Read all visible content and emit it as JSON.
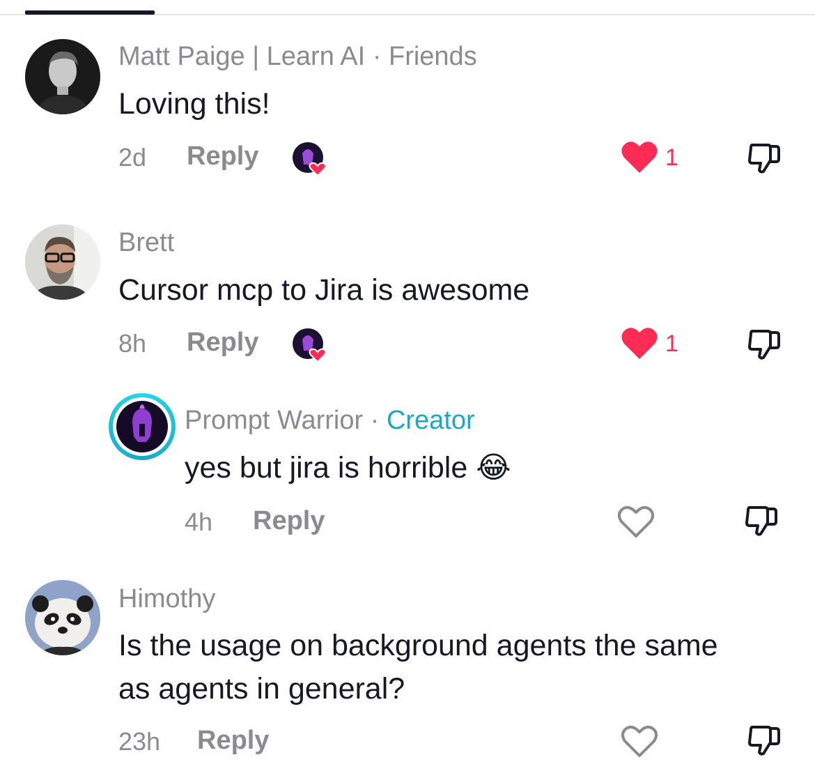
{
  "colors": {
    "like_red": "#fe2c55",
    "creator_teal": "#1ba7c8",
    "muted_gray": "#8a8b91",
    "text_dark": "#161823"
  },
  "comments": [
    {
      "author": "Matt Paige | Learn AI",
      "tag": "Friends",
      "text": "Loving this!",
      "time": "2d",
      "reply_label": "Reply",
      "liked": true,
      "like_count": "1",
      "creator_liked": true
    },
    {
      "author": "Brett",
      "text": "Cursor mcp to Jira is awesome",
      "time": "8h",
      "reply_label": "Reply",
      "liked": true,
      "like_count": "1",
      "creator_liked": true
    },
    {
      "author": "Prompt Warrior",
      "tag": "Creator",
      "text": "yes but jira is horrible",
      "emoji": "😂",
      "time": "4h",
      "reply_label": "Reply",
      "liked": false,
      "is_reply": true
    },
    {
      "author": "Himothy",
      "text_line1": "Is the usage on background agents the same",
      "text_line2": "as agents in general?",
      "time": "23h",
      "reply_label": "Reply",
      "liked": false
    }
  ],
  "icons": {
    "like_filled": "heart-filled-icon",
    "like_outline": "heart-outline-icon",
    "dislike": "thumbs-down-icon",
    "creator_liked": "creator-liked-badge-icon"
  }
}
